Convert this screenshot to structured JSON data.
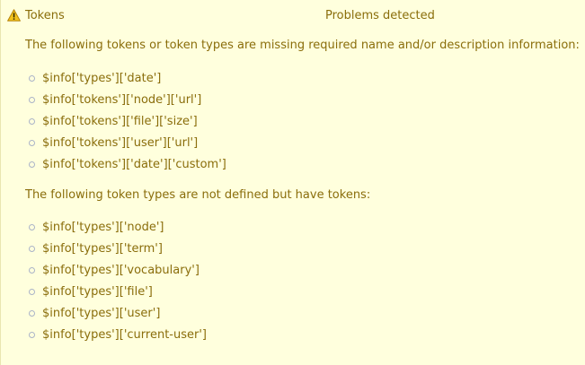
{
  "status": {
    "title": "Tokens",
    "severity_text": "Problems detected",
    "icon": "warning-icon",
    "colors": {
      "background": "#ffffdd",
      "text": "#8a6d0b",
      "bullet": "#aab3c8"
    }
  },
  "sections": [
    {
      "intro": "The following tokens or token types are missing required name and/or description information:",
      "items": [
        "$info['types']['date']",
        "$info['tokens']['node']['url']",
        "$info['tokens']['file']['size']",
        "$info['tokens']['user']['url']",
        "$info['tokens']['date']['custom']"
      ]
    },
    {
      "intro": "The following token types are not defined but have tokens:",
      "items": [
        "$info['types']['node']",
        "$info['types']['term']",
        "$info['types']['vocabulary']",
        "$info['types']['file']",
        "$info['types']['user']",
        "$info['types']['current-user']"
      ]
    }
  ]
}
